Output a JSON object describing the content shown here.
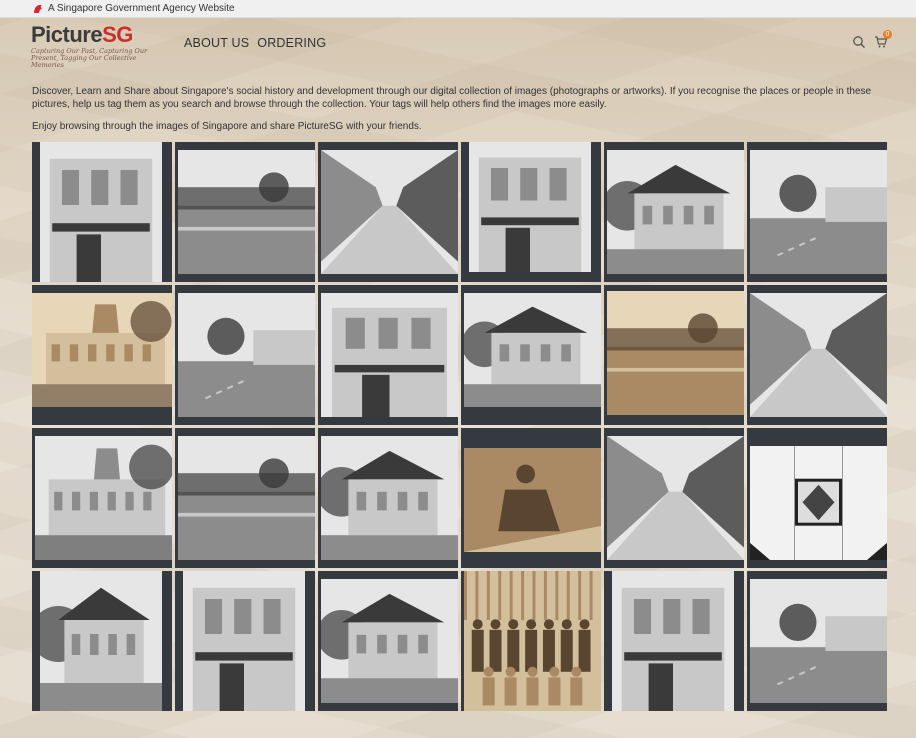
{
  "gov_bar": {
    "text": "A Singapore Government Agency Website",
    "icon": "lion-head-icon"
  },
  "logo": {
    "title_part1": "Picture",
    "title_part2": "SG",
    "tagline": "Capturing Our Past, Capturing Our Present, Tagging Our Collective Memories"
  },
  "nav": {
    "items": [
      {
        "label": "ABOUT US"
      },
      {
        "label": "ORDERING"
      }
    ]
  },
  "header_icons": {
    "search": "search-icon",
    "cart": "cart-icon",
    "cart_count": "0"
  },
  "intro": {
    "paragraph1": "Discover, Learn and Share about Singapore's social history and development through our digital collection of images (photographs or artworks). If you recognise the places or people in these pictures, help us tag them as you search and browse through the collection. Your tags will help others find the images more easily.",
    "paragraph2": "Enjoy browsing through the images of Singapore and share PictureSG with your friends."
  },
  "colors": {
    "accent": "#c9302c",
    "tile_frame": "#353a40",
    "cart_badge": "#e67e22"
  },
  "gallery": {
    "items": [
      {
        "tone": "bw"
      },
      {
        "tone": "bw"
      },
      {
        "tone": "bw"
      },
      {
        "tone": "bw"
      },
      {
        "tone": "bw"
      },
      {
        "tone": "bw"
      },
      {
        "tone": "sepia"
      },
      {
        "tone": "bw"
      },
      {
        "tone": "bw"
      },
      {
        "tone": "bw"
      },
      {
        "tone": "sepia"
      },
      {
        "tone": "bw"
      },
      {
        "tone": "bw"
      },
      {
        "tone": "bw"
      },
      {
        "tone": "bw"
      },
      {
        "tone": "sepia"
      },
      {
        "tone": "bw"
      },
      {
        "tone": "bw"
      },
      {
        "tone": "bw"
      },
      {
        "tone": "bw"
      },
      {
        "tone": "bw"
      },
      {
        "tone": "sepia"
      },
      {
        "tone": "bw"
      },
      {
        "tone": "bw"
      }
    ]
  }
}
